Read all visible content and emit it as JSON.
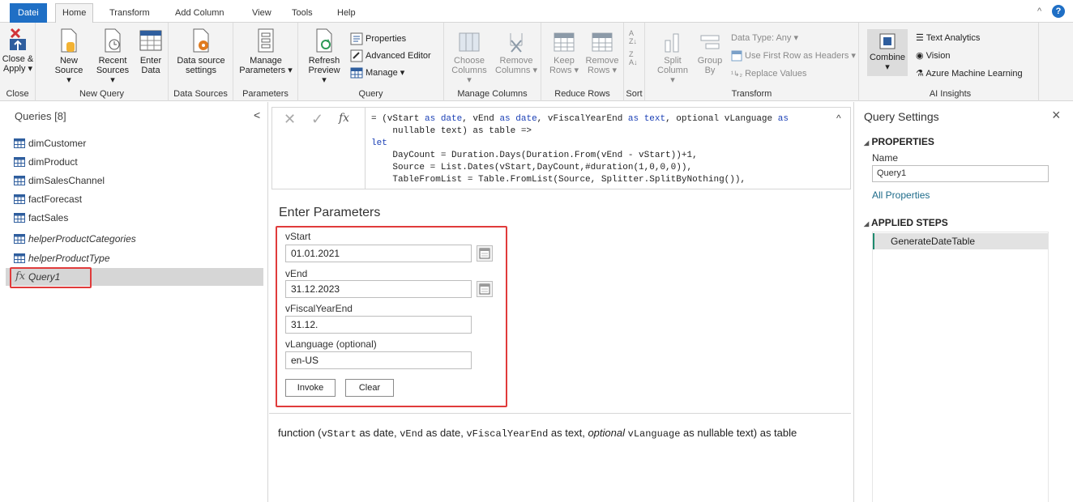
{
  "tabs": [
    "Datei",
    "Home",
    "Transform",
    "Add Column",
    "View",
    "Tools",
    "Help"
  ],
  "ribbon": {
    "close_group": {
      "label": "Close",
      "close_apply": "Close &",
      "close_apply2": "Apply ▾"
    },
    "new_query_group": {
      "label": "New Query",
      "new_source": "New",
      "new_source2": "Source ▾",
      "recent_sources": "Recent",
      "recent_sources2": "Sources ▾",
      "enter_data": "Enter",
      "enter_data2": "Data"
    },
    "data_sources_group": {
      "label": "Data Sources",
      "settings": "Data source",
      "settings2": "settings"
    },
    "parameters_group": {
      "label": "Parameters",
      "manage": "Manage",
      "manage2": "Parameters ▾"
    },
    "query_group": {
      "label": "Query",
      "refresh": "Refresh",
      "refresh2": "Preview ▾",
      "properties": "Properties",
      "advanced_editor": "Advanced Editor",
      "manage": "Manage ▾"
    },
    "manage_columns_group": {
      "label": "Manage Columns",
      "choose": "Choose",
      "choose2": "Columns ▾",
      "remove": "Remove",
      "remove2": "Columns ▾"
    },
    "reduce_rows_group": {
      "label": "Reduce Rows",
      "keep": "Keep",
      "keep2": "Rows ▾",
      "remove": "Remove",
      "remove2": "Rows ▾"
    },
    "sort_group": {
      "label": "Sort"
    },
    "transform_group": {
      "label": "Transform",
      "split": "Split",
      "split2": "Column ▾",
      "group": "Group",
      "group2": "By",
      "data_type": "Data Type: Any ▾",
      "first_row": "Use First Row as Headers ▾",
      "replace": "Replace Values"
    },
    "ai_group": {
      "label": "AI Insights",
      "combine": "Combine",
      "combine2": "▾",
      "text_analytics": "Text Analytics",
      "vision": "Vision",
      "azure_ml": "Azure Machine Learning"
    }
  },
  "queries": {
    "header": "Queries [8]",
    "collapse": "<",
    "items": [
      "dimCustomer",
      "dimProduct",
      "dimSalesChannel",
      "factForecast",
      "factSales",
      "helperProductCategories",
      "helperProductType",
      "Query1"
    ]
  },
  "formula": {
    "fx": "fx",
    "lines": [
      [
        "= (vStart ",
        "as",
        " ",
        "date",
        ", vEnd ",
        "as",
        " ",
        "date",
        ", vFiscalYearEnd ",
        "as",
        " ",
        "text",
        ", optional vLanguage ",
        "as"
      ],
      "    nullable text) as table =>",
      "let",
      "    DayCount = Duration.Days(Duration.From(vEnd - vStart))+1,",
      "    Source = List.Dates(vStart,DayCount,#duration(1,0,0,0)),",
      "    TableFromList = Table.FromList(Source, Splitter.SplitByNothing()),"
    ]
  },
  "params": {
    "title": "Enter Parameters",
    "fields": [
      {
        "label": "vStart",
        "value": "01.01.2021"
      },
      {
        "label": "vEnd",
        "value": "31.12.2023"
      },
      {
        "label": "vFiscalYearEnd",
        "value": "31.12."
      },
      {
        "label": "vLanguage (optional)",
        "value": "en-US"
      }
    ],
    "invoke": "Invoke",
    "clear": "Clear"
  },
  "func_desc": {
    "p1": "function (",
    "v1": "vStart",
    "p2": " as date, ",
    "v2": "vEnd",
    "p3": " as date, ",
    "v3": "vFiscalYearEnd",
    "p4": " as text, ",
    "opt": "optional",
    "p5": " ",
    "v4": "vLanguage",
    "p6": " as nullable text) as table"
  },
  "settings": {
    "title": "Query Settings",
    "close": "×",
    "properties": "PROPERTIES",
    "name_label": "Name",
    "name_value": "Query1",
    "all_properties": "All Properties",
    "applied_steps": "APPLIED STEPS",
    "step": "GenerateDateTable"
  },
  "colors": {
    "accent": "#1f6fc5",
    "highlight": "#e03b3b",
    "step_accent": "#1e8a6e"
  }
}
